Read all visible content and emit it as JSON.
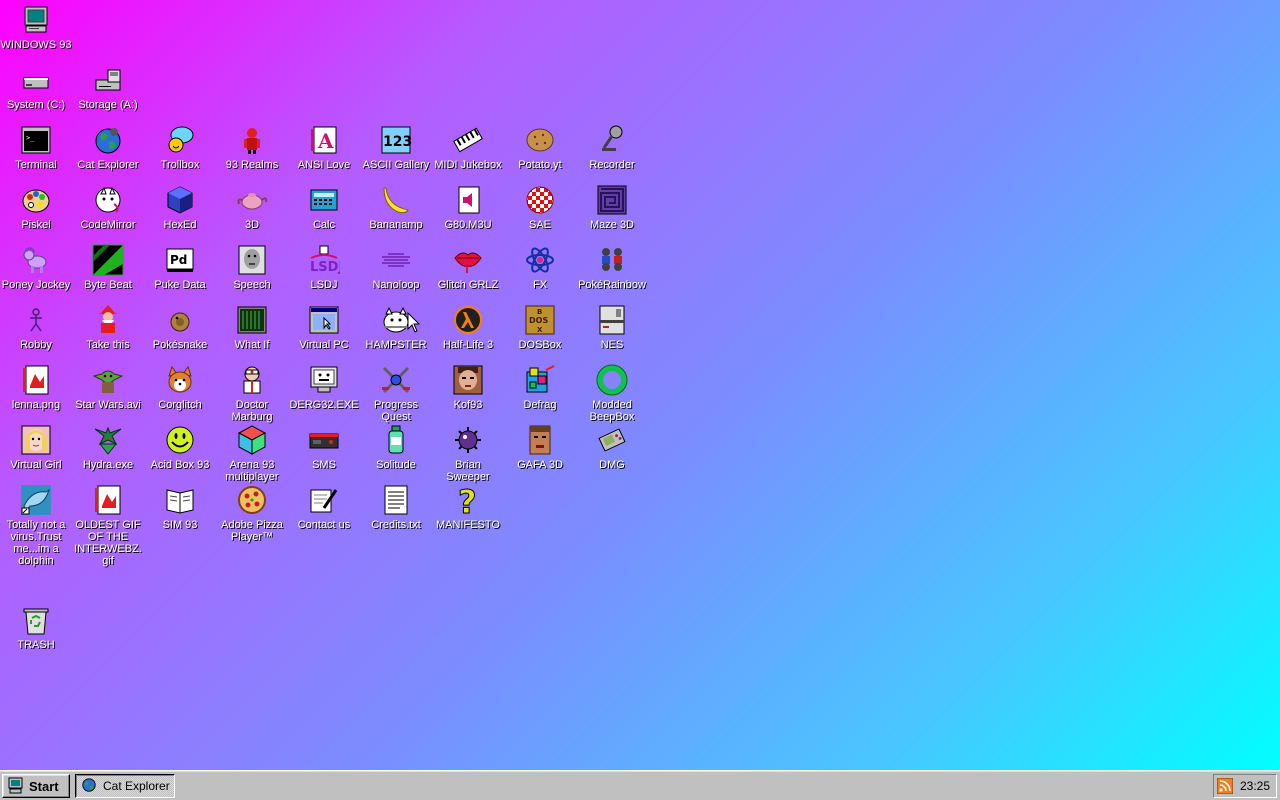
{
  "desktop": {
    "icons": {
      "windows93": {
        "label": "WINDOWS 93",
        "icon": "computer-icon"
      },
      "system_c": {
        "label": "System (C:)",
        "icon": "drive-icon"
      },
      "storage_a": {
        "label": "Storage (A:)",
        "icon": "floppy-drive-icon"
      },
      "terminal": {
        "label": "Terminal",
        "icon": "terminal-icon"
      },
      "cat_explorer": {
        "label": "Cat Explorer",
        "icon": "globe-icon"
      },
      "trollbox": {
        "label": "Trollbox",
        "icon": "chat-bubble-icon"
      },
      "realms": {
        "label": "93 Realms",
        "icon": "knight-icon"
      },
      "ansi_love": {
        "label": "ANSI Love",
        "icon": "letter-a-icon"
      },
      "ascii_gallery": {
        "label": "ASCII Gallery",
        "icon": "numbers-icon"
      },
      "midi_jukebox": {
        "label": "MIDI Jukebox",
        "icon": "piano-icon"
      },
      "potato": {
        "label": "Potato.yt",
        "icon": "potato-icon"
      },
      "recorder": {
        "label": "Recorder",
        "icon": "microphone-icon"
      },
      "piskel": {
        "label": "Piskel",
        "icon": "palette-icon"
      },
      "codemirror": {
        "label": "CodeMirror",
        "icon": "cat-icon"
      },
      "hexed": {
        "label": "HexEd",
        "icon": "cube-icon"
      },
      "three_d": {
        "label": "3D",
        "icon": "teapot-icon"
      },
      "calc": {
        "label": "Calc",
        "icon": "calculator-icon"
      },
      "bananamp": {
        "label": "Bananamp",
        "icon": "banana-icon"
      },
      "g80m3u": {
        "label": "G80.M3U",
        "icon": "speaker-file-icon"
      },
      "sae": {
        "label": "SAE",
        "icon": "checkered-ball-icon"
      },
      "maze3d": {
        "label": "Maze 3D",
        "icon": "maze-icon"
      },
      "poney": {
        "label": "Poney Jockey",
        "icon": "pony-icon"
      },
      "bytebeat": {
        "label": "Byte Beat",
        "icon": "green-wave-icon"
      },
      "pukedata": {
        "label": "Puke Data",
        "icon": "pd-icon"
      },
      "speech": {
        "label": "Speech",
        "icon": "face-icon"
      },
      "lsdj": {
        "label": "LSDJ",
        "icon": "lsdj-icon"
      },
      "nanoloop": {
        "label": "Nanoloop",
        "icon": "waveform-icon"
      },
      "glitchgrlz": {
        "label": "Glitch GRLZ",
        "icon": "lips-icon"
      },
      "fx": {
        "label": "FX",
        "icon": "atom-icon"
      },
      "pokerainbow": {
        "label": "PokéRainbow",
        "icon": "trainers-icon"
      },
      "robby": {
        "label": "Robby",
        "icon": "stick-figure-icon"
      },
      "takethis": {
        "label": "Take this",
        "icon": "old-man-icon"
      },
      "pokesnake": {
        "label": "Pokésnake",
        "icon": "snake-ball-icon"
      },
      "whatif": {
        "label": "What If",
        "icon": "green-screen-icon"
      },
      "virtualpc": {
        "label": "Virtual PC",
        "icon": "window-icon"
      },
      "hampster": {
        "label": "HAMPSTER",
        "icon": "hamster-icon"
      },
      "halflife3": {
        "label": "Half-Life 3",
        "icon": "lambda-icon"
      },
      "dosbox": {
        "label": "DOSBox",
        "icon": "box-icon"
      },
      "nes": {
        "label": "NES",
        "icon": "nes-icon"
      },
      "lenna": {
        "label": "lenna.png",
        "icon": "image-file-icon"
      },
      "starwars": {
        "label": "Star Wars.avi",
        "icon": "yoda-icon"
      },
      "corglitch": {
        "label": "Corglitch",
        "icon": "corgi-icon"
      },
      "marburg": {
        "label": "Doctor Marburg",
        "icon": "doctor-icon"
      },
      "derg32": {
        "label": "DERG32.EXE",
        "icon": "monitor-face-icon"
      },
      "progressquest": {
        "label": "Progress Quest",
        "icon": "crossed-swords-icon"
      },
      "kof93": {
        "label": "Kof93",
        "icon": "fighter-icon"
      },
      "defrag": {
        "label": "Defrag",
        "icon": "defrag-icon"
      },
      "beepbox": {
        "label": "Modded BeepBox",
        "icon": "green-ring-icon"
      },
      "virtualgirl": {
        "label": "Virtual Girl",
        "icon": "girl-icon"
      },
      "hydra": {
        "label": "Hydra.exe",
        "icon": "dragon-icon"
      },
      "acidbox": {
        "label": "Acid Box 93",
        "icon": "smiley-icon"
      },
      "arena93": {
        "label": "Arena 93 multiplayer",
        "icon": "color-cube-icon"
      },
      "sms": {
        "label": "SMS",
        "icon": "console-icon"
      },
      "solitude": {
        "label": "Solitude",
        "icon": "bottle-icon"
      },
      "brian": {
        "label": "Brian Sweeper",
        "icon": "mine-icon"
      },
      "gafa3d": {
        "label": "GAFA 3D",
        "icon": "doom-face-icon"
      },
      "dmg": {
        "label": "DMG",
        "icon": "gameboy-icon"
      },
      "dolphin": {
        "label": "Totally not a virus.Trust me...im a dolphin",
        "icon": "dolphin-icon"
      },
      "oldestgif": {
        "label": "OLDEST GIF OF THE INTERWEBZ.gif",
        "icon": "gif-file-icon"
      },
      "sim93": {
        "label": "SIM 93",
        "icon": "book-icon"
      },
      "pizza": {
        "label": "Adobe Pizza Player™",
        "icon": "pizza-icon"
      },
      "contact": {
        "label": "Contact us",
        "icon": "letter-pen-icon"
      },
      "credits": {
        "label": "Credits.txt",
        "icon": "text-file-icon"
      },
      "manifesto": {
        "label": "MANIFESTO",
        "icon": "question-mark-icon"
      },
      "trash": {
        "label": "TRASH",
        "icon": "recycle-bin-icon"
      }
    }
  },
  "taskbar": {
    "start_label": "Start",
    "task_label": "Cat Explorer",
    "clock": "23:25",
    "tray_icon": "rss-icon"
  },
  "colors": {
    "gradient_start": "#ff00ff",
    "gradient_end": "#00ffff",
    "taskbar": "#c0c0c0"
  }
}
